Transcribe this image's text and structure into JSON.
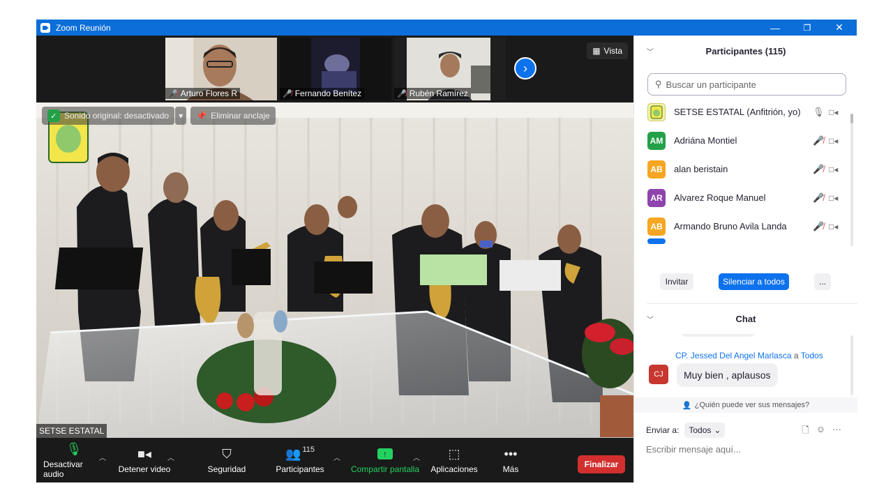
{
  "window": {
    "title": "Zoom Reunión",
    "controls": {
      "minimize": "—",
      "restore": "❐",
      "close": "✕"
    }
  },
  "meeting": {
    "thumbnails": [
      {
        "name": "Arturo Flores R",
        "muted": true
      },
      {
        "name": "Fernando Benítez",
        "muted": true
      },
      {
        "name": "Rubén Ramírez",
        "muted": true
      }
    ],
    "view_label": "Vista",
    "next_icon": "chevron-right",
    "overlay": {
      "original_sound": "Sonido original: desactivado",
      "unpin": "Eliminar anclaje"
    },
    "speaker_name": "SETSE ESTATAL"
  },
  "toolbar": {
    "audio": "Desactivar audio",
    "video": "Detener video",
    "security": "Seguridad",
    "participants": "Participantes",
    "participants_count": "115",
    "share": "Compartir pantalla",
    "apps": "Aplicaciones",
    "more": "Más",
    "end": "Finalizar"
  },
  "participants_panel": {
    "title": "Participantes (115)",
    "search_placeholder": "Buscar un participante",
    "list": [
      {
        "initials": "",
        "name": "SETSE ESTATAL (Anfitrión, yo)",
        "color": "#f3f3a0",
        "mic_muted": false
      },
      {
        "initials": "AM",
        "name": "Adriána Montiel",
        "color": "#24a148",
        "mic_muted": true
      },
      {
        "initials": "AB",
        "name": "alan beristain",
        "color": "#f5a623",
        "mic_muted": true
      },
      {
        "initials": "AR",
        "name": "Alvarez Roque Manuel",
        "color": "#8e44ad",
        "mic_muted": true
      },
      {
        "initials": "AB",
        "name": "Armando Bruno Avila Landa",
        "color": "#f5a623",
        "mic_muted": true
      }
    ],
    "invite": "Invitar",
    "mute_all": "Silenciar a todos",
    "more": "..."
  },
  "chat": {
    "title": "Chat",
    "message": {
      "sender": "CP. Jessed  Del Angel Marlasca",
      "to_word": "a",
      "recipient": "Todos",
      "initials": "CJ",
      "text": "Muy bien , aplausos"
    },
    "who_can_see": "¿Quién puede ver sus mensajes?",
    "send_to_label": "Enviar a:",
    "send_to_value": "Todos",
    "compose_placeholder": "Escribir mensaje aquí..."
  },
  "colors": {
    "accent": "#0e72ed",
    "titlebar": "#0b6ed9",
    "end_button": "#d32f2f",
    "share_green": "#23d160",
    "muted_red": "#e5484d"
  }
}
